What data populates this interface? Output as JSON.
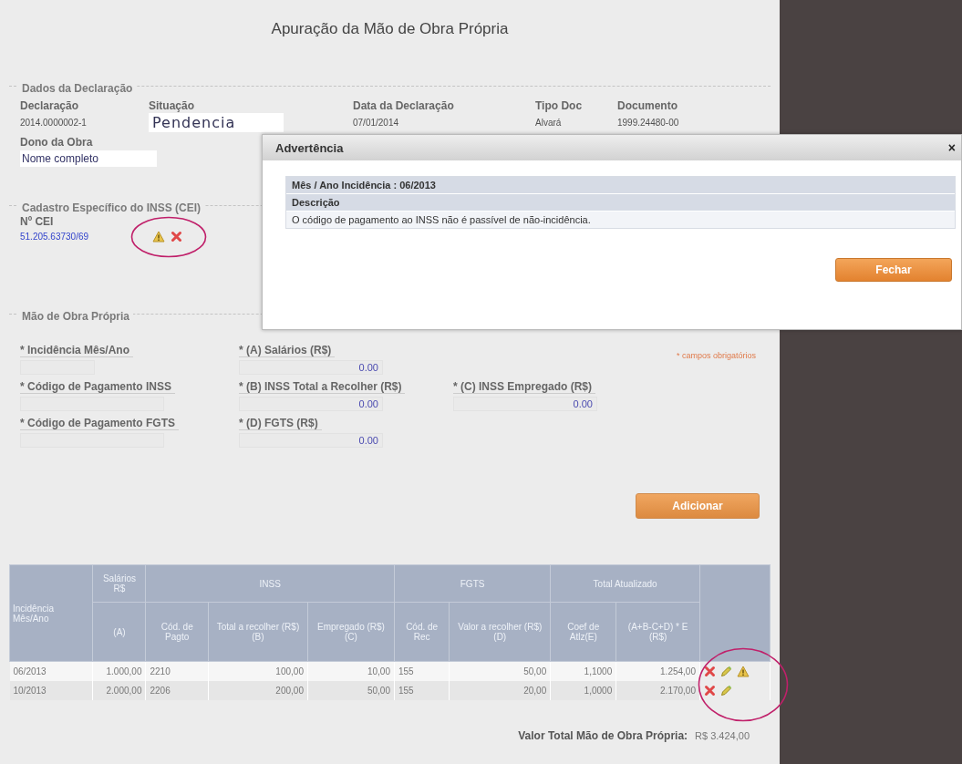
{
  "title": "Apuração da Mão de Obra Própria",
  "declaration": {
    "legend": "Dados da Declaração",
    "fields": [
      {
        "label": "Declaração",
        "value": "2014.0000002-1",
        "kind": "plain"
      },
      {
        "label": "Situação",
        "value": "Pendencia",
        "kind": "pasted"
      },
      {
        "label": "Data da Declaração",
        "value": "07/01/2014",
        "kind": "plain"
      },
      {
        "label": "Tipo Doc",
        "value": "Alvará",
        "kind": "plain"
      },
      {
        "label": "Documento",
        "value": "1999.24480-00",
        "kind": "plain"
      }
    ],
    "owner": {
      "label": "Dono da Obra",
      "value": "Nome completo"
    }
  },
  "cei": {
    "legend": "Cadastro Específico do INSS (CEI)",
    "label": "Nº CEI",
    "value": "51.205.63730/69",
    "circled": true,
    "actions": [
      {
        "kind": "warning"
      },
      {
        "kind": "delete"
      }
    ]
  },
  "labor": {
    "legend": "Mão de Obra Própria",
    "required_note": "* campos obrigatórios",
    "rows": [
      [
        {
          "label": "* Incidência Mês/Ano",
          "kind": "short"
        },
        {
          "label": "* (A) Salários (R$)",
          "value": "0.00",
          "kind": "amount"
        }
      ],
      [
        {
          "label": "* Código de Pagamento INSS",
          "kind": "code"
        },
        {
          "label": "* (B) INSS Total a Recolher (R$)",
          "value": "0.00",
          "kind": "amount"
        },
        {
          "label": "* (C) INSS Empregado (R$)",
          "value": "0.00",
          "kind": "amount"
        }
      ],
      [
        {
          "label": "* Código de Pagamento FGTS",
          "kind": "code"
        },
        {
          "label": "* (D) FGTS (R$)",
          "value": "0.00",
          "kind": "amount"
        }
      ]
    ],
    "add_button": "Adicionar"
  },
  "table": {
    "group_headers": [
      "Incidência Mês/Ano",
      "Salários R$",
      "INSS",
      "FGTS",
      "Total Atualizado"
    ],
    "columns": [
      "",
      "(A)",
      "Cód. de Pagto",
      "Total a recolher (R$) (B)",
      "Empregado (R$) (C)",
      "Cód. de Rec",
      "Valor a recolher (R$) (D)",
      "Coef de Atlz(E)",
      "(A+B-C+D) * E (R$)"
    ],
    "actions_circled": true,
    "rows": [
      {
        "cells": [
          "06/2013",
          "1.000,00",
          "2210",
          "100,00",
          "10,00",
          "155",
          "50,00",
          "1,1000",
          "1.254,00"
        ],
        "actions": [
          {
            "kind": "delete"
          },
          {
            "kind": "edit"
          },
          {
            "kind": "warning"
          }
        ]
      },
      {
        "cells": [
          "10/2013",
          "2.000,00",
          "2206",
          "200,00",
          "50,00",
          "155",
          "20,00",
          "1,0000",
          "2.170,00"
        ],
        "actions": [
          {
            "kind": "delete"
          },
          {
            "kind": "edit"
          }
        ]
      }
    ],
    "total_label": "Valor Total Mão de Obra Própria:",
    "total_value": "R$ 3.424,00"
  },
  "dialog": {
    "title": "Advertência",
    "close": "×",
    "rows": [
      {
        "text": "Mês / Ano Incidência : 06/2013",
        "kind": "header"
      },
      {
        "text": "Descrição",
        "kind": "header"
      },
      {
        "text": "O código de pagamento ao INSS não é passível de não-incidência.",
        "kind": "body"
      }
    ],
    "button": "Fechar"
  }
}
